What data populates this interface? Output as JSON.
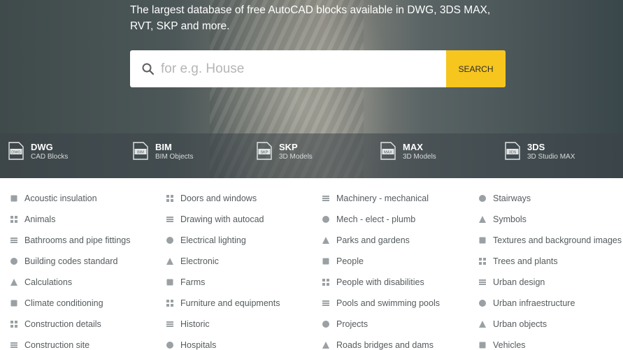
{
  "hero": {
    "tagline": "The largest database of free AutoCAD blocks available in DWG, 3DS MAX, RVT, SKP and more."
  },
  "search": {
    "placeholder": "for e.g. House",
    "button_label": "SEARCH",
    "accent_color": "#f6c61f"
  },
  "formats": [
    {
      "badge": "DWG",
      "name": "DWG",
      "sub": "CAD Blocks",
      "icon": "file-icon"
    },
    {
      "badge": "BIM",
      "name": "BIM",
      "sub": "BIM Objects",
      "icon": "file-icon"
    },
    {
      "badge": "SKP",
      "name": "SKP",
      "sub": "3D Models",
      "icon": "file-icon"
    },
    {
      "badge": "MAX",
      "name": "MAX",
      "sub": "3D Models",
      "icon": "file-icon"
    },
    {
      "badge": "3DS",
      "name": "3DS",
      "sub": "3D Studio MAX",
      "icon": "file-icon"
    }
  ],
  "categories": {
    "col1": [
      {
        "label": "Acoustic insulation",
        "icon": "ear-icon"
      },
      {
        "label": "Animals",
        "icon": "paw-icon"
      },
      {
        "label": "Bathrooms and pipe fittings",
        "icon": "bathtub-icon"
      },
      {
        "label": "Building codes standard",
        "icon": "building-icon"
      },
      {
        "label": "Calculations",
        "icon": "calculator-icon"
      },
      {
        "label": "Climate conditioning",
        "icon": "air-conditioner-icon"
      },
      {
        "label": "Construction details",
        "icon": "grid-icon"
      },
      {
        "label": "Construction site",
        "icon": "crane-icon"
      }
    ],
    "col2": [
      {
        "label": "Doors and windows",
        "icon": "door-icon"
      },
      {
        "label": "Drawing with autocad",
        "icon": "drafting-icon"
      },
      {
        "label": "Electrical lighting",
        "icon": "bulb-icon"
      },
      {
        "label": "Electronic",
        "icon": "monitor-icon"
      },
      {
        "label": "Farms",
        "icon": "tractor-icon"
      },
      {
        "label": "Furniture and equipments",
        "icon": "armchair-icon"
      },
      {
        "label": "Historic",
        "icon": "column-icon"
      },
      {
        "label": "Hospitals",
        "icon": "hospital-icon"
      }
    ],
    "col3": [
      {
        "label": "Machinery - mechanical",
        "icon": "machinery-icon"
      },
      {
        "label": "Mech - elect - plumb",
        "icon": "plumbing-icon"
      },
      {
        "label": "Parks and gardens",
        "icon": "tree-icon"
      },
      {
        "label": "People",
        "icon": "people-icon"
      },
      {
        "label": "People with disabilities",
        "icon": "wheelchair-icon"
      },
      {
        "label": "Pools and swimming pools",
        "icon": "pool-icon"
      },
      {
        "label": "Projects",
        "icon": "projects-icon"
      },
      {
        "label": "Roads bridges and dams",
        "icon": "road-icon"
      }
    ],
    "col4": [
      {
        "label": "Stairways",
        "icon": "stairs-icon"
      },
      {
        "label": "Symbols",
        "icon": "symbol-icon"
      },
      {
        "label": "Textures and background images",
        "icon": "texture-icon"
      },
      {
        "label": "Trees and plants",
        "icon": "leaf-icon"
      },
      {
        "label": "Urban design",
        "icon": "city-icon"
      },
      {
        "label": "Urban infraestructure",
        "icon": "lamp-post-icon"
      },
      {
        "label": "Urban objects",
        "icon": "bench-icon"
      },
      {
        "label": "Vehicles",
        "icon": "car-icon"
      }
    ]
  }
}
